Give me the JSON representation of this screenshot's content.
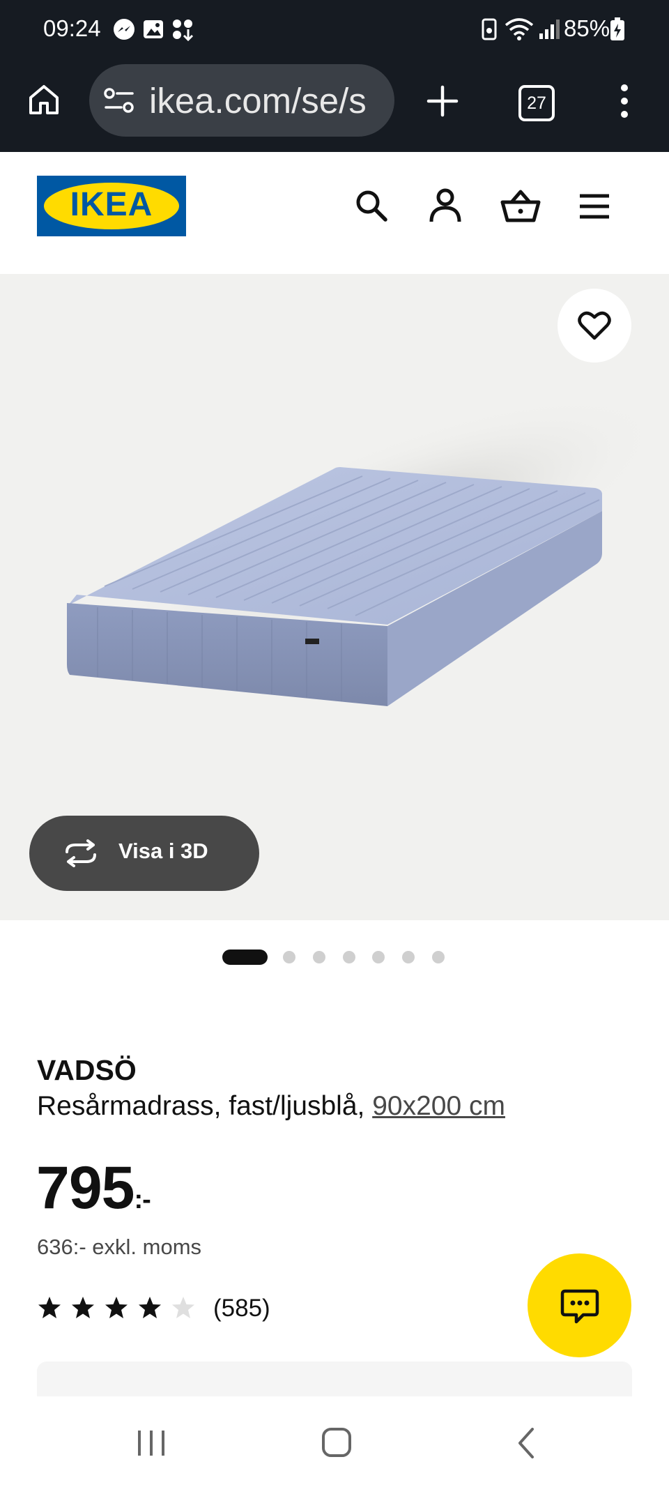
{
  "status_bar": {
    "time": "09:24",
    "battery": "85%",
    "icons": [
      "messenger-icon",
      "gallery-icon",
      "apps-icon",
      "battery-saver-icon",
      "wifi-icon",
      "signal-icon",
      "battery-icon"
    ]
  },
  "browser": {
    "url": "ikea.com/se/s",
    "tab_count": "27",
    "icons": [
      "home-icon",
      "site-settings-icon",
      "new-tab-icon",
      "tabs-icon",
      "more-icon"
    ]
  },
  "header": {
    "logo_text": "IKEA",
    "icons": [
      "search-icon",
      "user-icon",
      "cart-icon",
      "menu-icon"
    ]
  },
  "hero": {
    "view_3d_label": "Visa i 3D",
    "image_count": 7,
    "active_image": 1
  },
  "product": {
    "name": "VADSÖ",
    "description": "Resårmadrass, fast/ljusblå,",
    "size": "90x200 cm",
    "price": "795",
    "price_suffix": ":-",
    "price_ex_vat": "636:- exkl. moms",
    "rating": 4,
    "rating_max": 5,
    "reviews": "(585)"
  },
  "colors": {
    "brand_blue": "#0058a3",
    "brand_yellow": "#ffdb00",
    "status_bg": "#161b22"
  }
}
